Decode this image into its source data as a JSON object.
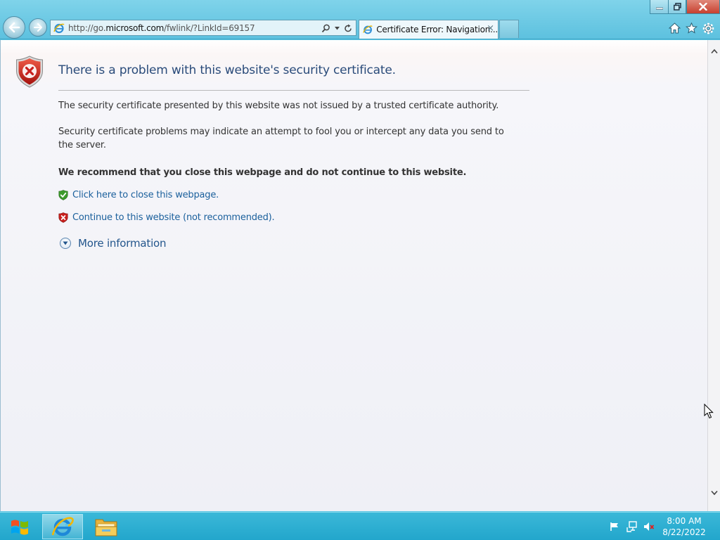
{
  "browser": {
    "address_url_prefix": "http://go.",
    "address_url_domain": "microsoft.com",
    "address_url_path": "/fwlink/?LinkId=69157",
    "tab_title": "Certificate Error: Navigation...",
    "tab_close_glyph": "×"
  },
  "page": {
    "title": "There is a problem with this website's security certificate.",
    "paragraph1": "The security certificate presented by this website was not issued by a trusted certificate authority.",
    "paragraph2": "Security certificate problems may indicate an attempt to fool you or intercept any data you send to the server.",
    "recommendation": "We recommend that you close this webpage and do not continue to this website.",
    "close_link": "Click here to close this webpage.",
    "continue_link": "Continue to this website (not recommended).",
    "more_info": "More information"
  },
  "taskbar": {
    "time": "8:00 AM",
    "date": "8/22/2022"
  },
  "colors": {
    "chrome": "#5dc1df",
    "title_text": "#2a4b7a",
    "link": "#1a5f9c",
    "error_red": "#c8201e",
    "ok_green": "#3c9a2c"
  },
  "icons": {
    "back": "arrow-left-icon",
    "forward": "arrow-right-icon",
    "home": "home-icon",
    "favorites": "star-icon",
    "tools": "gear-icon",
    "error": "shield-x-icon",
    "ok": "shield-check-icon"
  }
}
